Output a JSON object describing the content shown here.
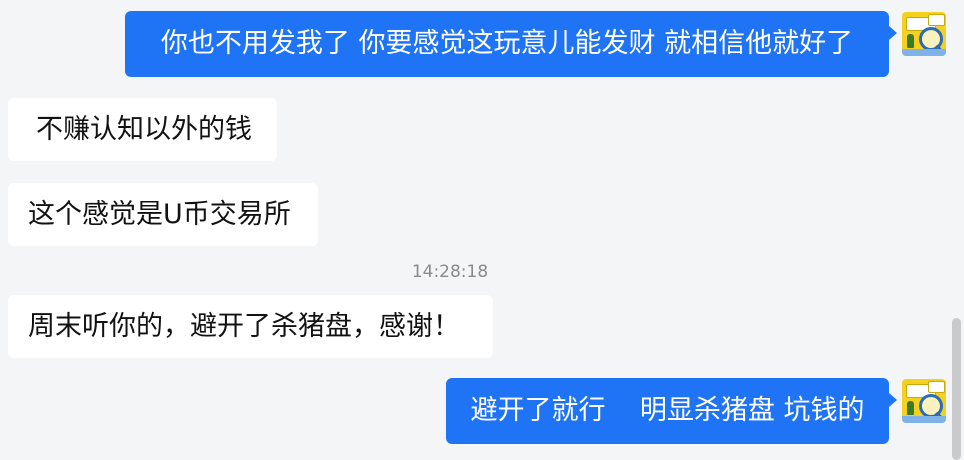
{
  "conversation": {
    "messages": [
      {
        "direction": "outgoing",
        "text": "你也不用发我了 你要感觉这玩意儿能发财  就相信他就好了"
      },
      {
        "direction": "incoming",
        "text": "不赚认知以外的钱"
      },
      {
        "direction": "incoming",
        "text": "这个感觉是U币交易所"
      },
      {
        "direction": "incoming",
        "text": "周末听你的，避开了杀猪盘，感谢！"
      },
      {
        "direction": "outgoing",
        "text": "避开了就行    明显杀猪盘 坑钱的"
      }
    ],
    "timestamp": "14:28:18"
  },
  "colors": {
    "background": "#f4f5f7",
    "outgoing_bubble": "#1f74f5",
    "incoming_bubble": "#ffffff",
    "timestamp_text": "#8a8a8a"
  },
  "icons": {
    "avatar": "user-avatar-magnifier-cartoon"
  }
}
